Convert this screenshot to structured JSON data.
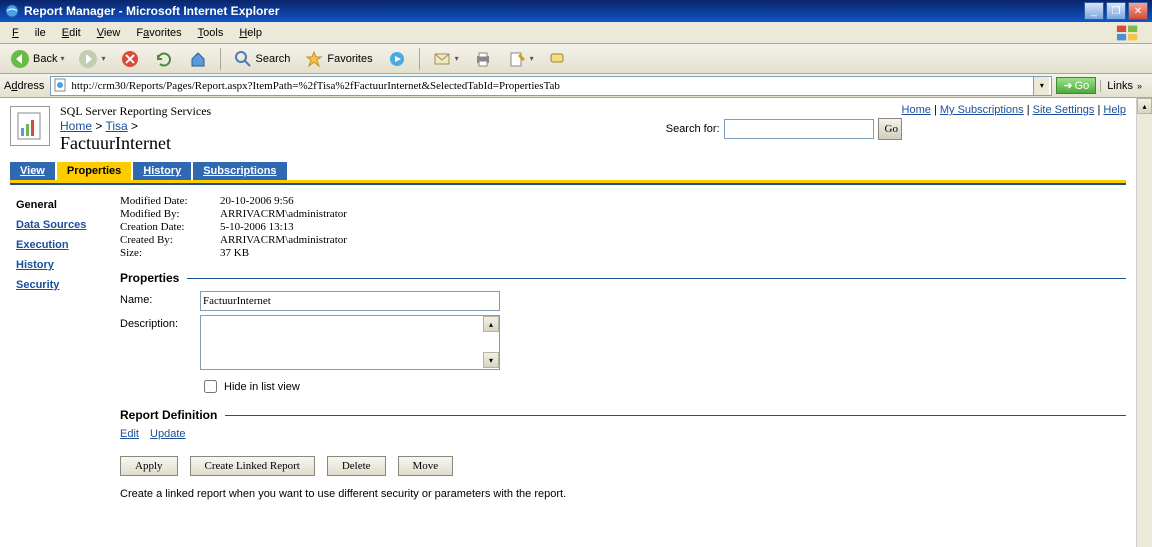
{
  "window": {
    "title": "Report Manager - Microsoft Internet Explorer"
  },
  "menubar": {
    "file": "File",
    "edit": "Edit",
    "view": "View",
    "favorites": "Favorites",
    "tools": "Tools",
    "help": "Help"
  },
  "toolbar": {
    "back": "Back",
    "search": "Search",
    "favorites": "Favorites"
  },
  "addressbar": {
    "label": "Address",
    "url": "http://crm30/Reports/Pages/Report.aspx?ItemPath=%2fTisa%2fFactuurInternet&SelectedTabId=PropertiesTab",
    "go": "Go",
    "links": "Links"
  },
  "topnav": {
    "home": "Home",
    "mysubs": "My Subscriptions",
    "sitesettings": "Site Settings",
    "help": "Help"
  },
  "header": {
    "service": "SQL Server Reporting Services",
    "crumb_home": "Home",
    "crumb_folder": "Tisa",
    "item": "FactuurInternet",
    "search_label": "Search for:",
    "go": "Go"
  },
  "tabs": {
    "view": "View",
    "properties": "Properties",
    "history": "History",
    "subscriptions": "Subscriptions"
  },
  "sidenav": {
    "general": "General",
    "datasources": "Data Sources",
    "execution": "Execution",
    "history": "History",
    "security": "Security"
  },
  "info": {
    "modified_date_label": "Modified Date:",
    "modified_date": "20-10-2006 9:56",
    "modified_by_label": "Modified By:",
    "modified_by": "ARRIVACRM\\administrator",
    "creation_date_label": "Creation Date:",
    "creation_date": "5-10-2006 13:13",
    "created_by_label": "Created By:",
    "created_by": "ARRIVACRM\\administrator",
    "size_label": "Size:",
    "size": "37 KB"
  },
  "properties": {
    "section": "Properties",
    "name_label": "Name:",
    "name_value": "FactuurInternet",
    "desc_label": "Description:",
    "desc_value": "",
    "hide_label": "Hide in list view"
  },
  "definition": {
    "section": "Report Definition",
    "edit": "Edit",
    "update": "Update"
  },
  "buttons": {
    "apply": "Apply",
    "create_linked": "Create Linked Report",
    "delete": "Delete",
    "move": "Move"
  },
  "hint": "Create a linked report when you want to use different security or parameters with the report."
}
